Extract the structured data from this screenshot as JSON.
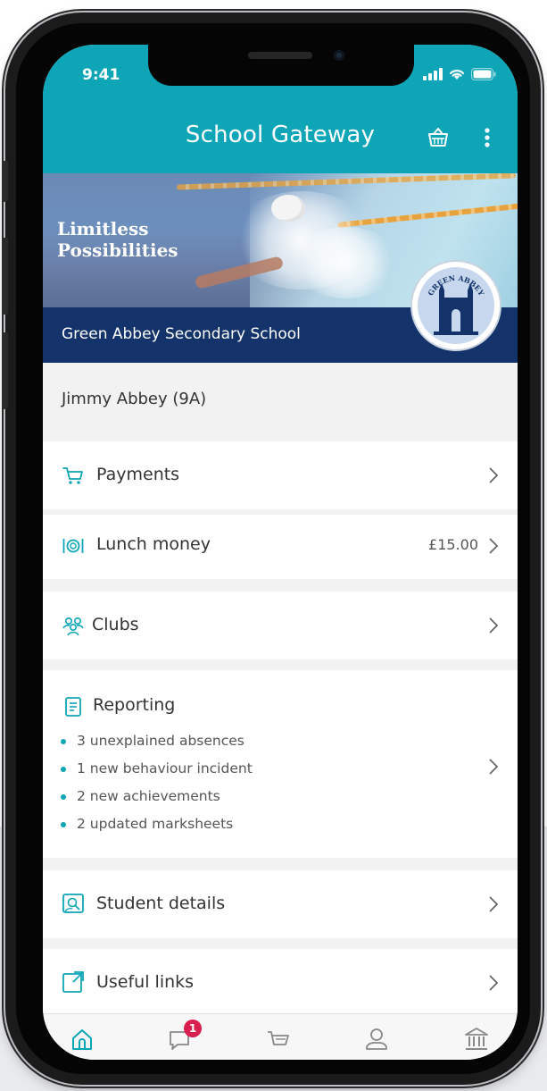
{
  "status_bar": {
    "time": "9:41"
  },
  "header": {
    "title": "School Gateway"
  },
  "banner": {
    "slogan": "Limitless\nPossibilities",
    "school_name": "Green Abbey Secondary School",
    "crest_text": "GREEN ABBEY"
  },
  "student": {
    "name": "Jimmy Abbey (9A)"
  },
  "menu": {
    "payments": {
      "label": "Payments"
    },
    "lunch": {
      "label": "Lunch money",
      "amount": "£15.00"
    },
    "clubs": {
      "label": "Clubs"
    },
    "reporting": {
      "label": "Reporting",
      "items": [
        "3 unexplained absences",
        "1 new behaviour incident",
        "2 new achievements",
        "2 updated marksheets"
      ]
    },
    "student_details": {
      "label": "Student details"
    },
    "useful_links": {
      "label": "Useful links"
    }
  },
  "tabbar": {
    "items": [
      "home-icon",
      "messages-icon",
      "basket-icon",
      "profile-icon",
      "school-icon"
    ],
    "messages_badge": "1"
  },
  "colors": {
    "teal": "#0ea5b6",
    "navy": "#13336a",
    "badge": "#d81f4f"
  }
}
